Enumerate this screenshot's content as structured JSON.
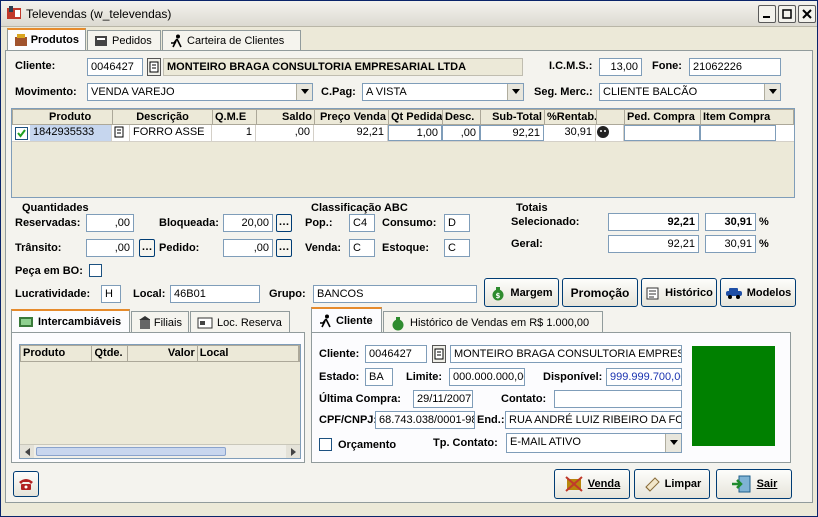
{
  "window": {
    "title": "Televendas (w_televendas)"
  },
  "main_tabs": [
    "Produtos",
    "Pedidos",
    "Carteira de Clientes"
  ],
  "header": {
    "cliente_label": "Cliente:",
    "cliente_code": "0046427",
    "cliente_name": "MONTEIRO BRAGA CONSULTORIA EMPRESARIAL LTDA",
    "icms_label": "I.C.M.S.:",
    "icms_value": "13,00",
    "fone_label": "Fone:",
    "fone_value": "21062226",
    "movimento_label": "Movimento:",
    "movimento_value": "VENDA VAREJO",
    "cpag_label": "C.Pag:",
    "cpag_value": "A VISTA",
    "segmerc_label": "Seg. Merc.:",
    "segmerc_value": "CLIENTE BALCÃO"
  },
  "product_grid": {
    "columns": [
      "Produto",
      "Descrição",
      "Q.M.E",
      "Saldo",
      "Preço Venda",
      "Qt Pedida",
      "Desc.",
      "Sub-Total",
      "%Rentab.",
      "Ped. Compra",
      "Item Compra"
    ],
    "rows": [
      {
        "produto": "1842935533",
        "descricao": "FORRO ASSE",
        "qme": "1",
        "saldo": ",00",
        "preco": "92,21",
        "qt": "1,00",
        "desc": ",00",
        "subtotal": "92,21",
        "rentab": "30,91",
        "ped_compra": "",
        "item_compra": ""
      }
    ]
  },
  "quantidades": {
    "title": "Quantidades",
    "reservadas_label": "Reservadas:",
    "reservadas": ",00",
    "bloqueada_label": "Bloqueada:",
    "bloqueada": "20,00",
    "transito_label": "Trânsito:",
    "transito": ",00",
    "pedido_label": "Pedido:",
    "pedido": ",00",
    "bo_label": "Peça em BO:"
  },
  "abc": {
    "title": "Classificação ABC",
    "pop_label": "Pop.:",
    "pop": "C4",
    "consumo_label": "Consumo:",
    "consumo": "D",
    "venda_label": "Venda:",
    "venda": "C",
    "estoque_label": "Estoque:",
    "estoque": "C"
  },
  "totais": {
    "title": "Totais",
    "selecionado_label": "Selecionado:",
    "selecionado": "92,21",
    "selecionado_pct": "30,91",
    "geral_label": "Geral:",
    "geral": "92,21",
    "geral_pct": "30,91",
    "pct_symbol": "%"
  },
  "info_row": {
    "lucratividade_label": "Lucratividade:",
    "lucratividade": "H",
    "local_label": "Local:",
    "local": "46B01",
    "grupo_label": "Grupo:",
    "grupo": "BANCOS"
  },
  "action_buttons": {
    "margem": "Margem",
    "promocao": "Promoção",
    "historico": "Histórico",
    "modelos": "Modelos"
  },
  "lower_left_tabs": [
    "Intercambiáveis",
    "Filiais",
    "Loc. Reserva"
  ],
  "inter_grid": {
    "columns": [
      "Produto",
      "Qtde.",
      "Valor",
      "Local"
    ]
  },
  "lower_right_tabs": [
    "Cliente",
    "Histórico de Vendas em R$ 1.000,00"
  ],
  "cliente_panel": {
    "cliente_label": "Cliente:",
    "cliente_code": "0046427",
    "cliente_name": "MONTEIRO BRAGA CONSULTORIA EMPRESARIAL",
    "estado_label": "Estado:",
    "estado": "BA",
    "limite_label": "Limite:",
    "limite": "000.000.000,00",
    "disponivel_label": "Disponível:",
    "disponivel": "999.999.700,00",
    "ultima_label": "Última Compra:",
    "ultima": "29/11/2007",
    "contato_label": "Contato:",
    "contato": "",
    "cpf_label": "CPF/CNPJ:",
    "cpf": "68.743.038/0001-98",
    "end_label": "End.:",
    "endereco": "RUA ANDRÉ LUIZ RIBEIRO DA FONTE",
    "orcamento_label": "Orçamento",
    "tpcontato_label": "Tp. Contato:",
    "tpcontato": "E-MAIL ATIVO",
    "status_color": "#008000"
  },
  "footer_buttons": {
    "venda": "Venda",
    "limpar": "Limpar",
    "sair": "Sair"
  }
}
